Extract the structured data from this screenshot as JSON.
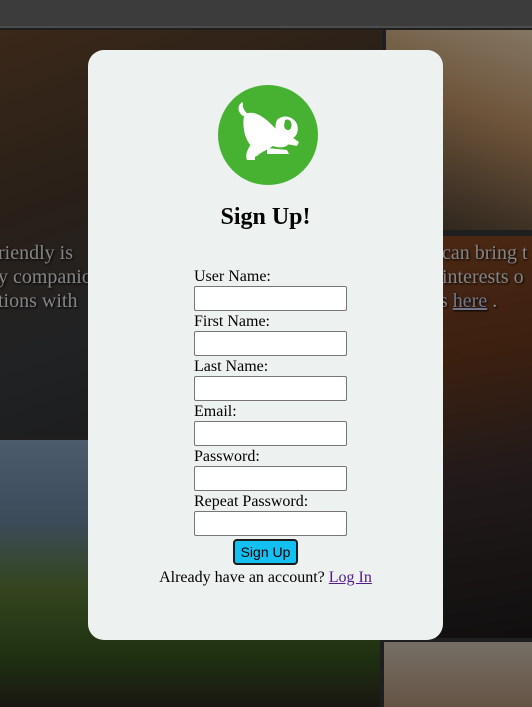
{
  "background": {
    "text_left_line1": "riendly is",
    "text_left_line2": "y companio",
    "text_left_line3": "tions with",
    "text_right_line1": "can bring t",
    "text_right_line2": "interests o",
    "text_right_line3_prefix": "gs",
    "text_right_link": "here",
    "text_right_line3_suffix": "."
  },
  "logo": {
    "icon": "dog-icon",
    "color": "#47b232"
  },
  "signup": {
    "title": "Sign Up!",
    "fields": [
      {
        "label": "User Name:",
        "value": ""
      },
      {
        "label": "First Name:",
        "value": ""
      },
      {
        "label": "Last Name:",
        "value": ""
      },
      {
        "label": "Email:",
        "value": ""
      },
      {
        "label": "Password:",
        "value": ""
      },
      {
        "label": "Repeat Password:",
        "value": ""
      }
    ],
    "submit_label": "Sign Up",
    "submit_color": "#14bff2",
    "login_prompt": "Already have an account?",
    "login_link": "Log In"
  }
}
